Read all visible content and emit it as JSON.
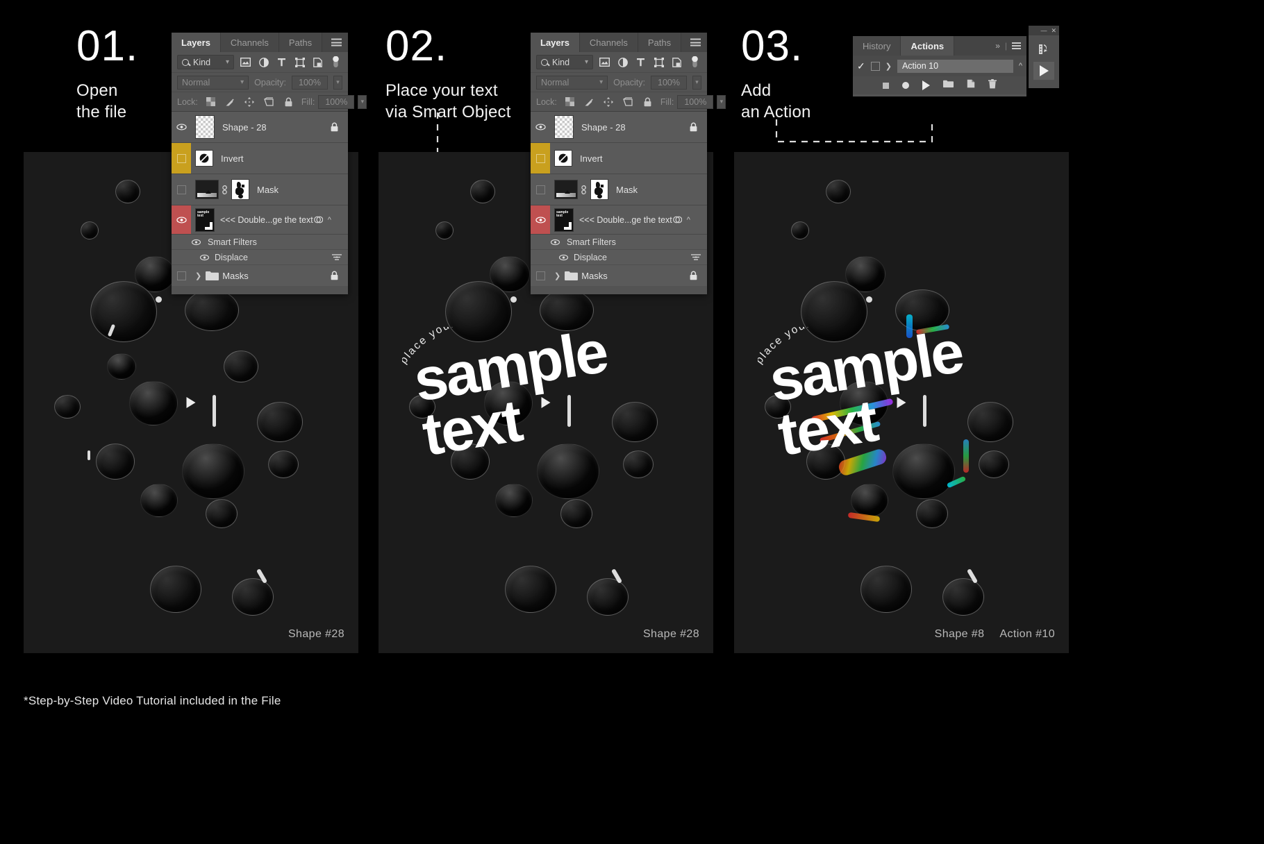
{
  "footnote": "*Step-by-Step Video Tutorial included in the File",
  "steps": [
    {
      "number": "01.",
      "title": "Open\nthe file",
      "caption": [
        "Shape #28"
      ],
      "artwork": {
        "arc_text": "",
        "sample_text": ""
      }
    },
    {
      "number": "02.",
      "title": "Place your text\nvia Smart Object",
      "caption": [
        "Shape #28"
      ],
      "artwork": {
        "arc_text": "place your text here",
        "sample_text": "sample\ntext"
      }
    },
    {
      "number": "03.",
      "title": "Add\nan Action",
      "caption": [
        "Shape #8",
        "Action #10"
      ],
      "artwork": {
        "arc_text": "place your text here",
        "sample_text": "sample\ntext"
      }
    }
  ],
  "layers_panel": {
    "tabs": [
      "Layers",
      "Channels",
      "Paths"
    ],
    "active_tab": "Layers",
    "menu_icon": "hamburger-icon",
    "filter": {
      "icon": "search-icon",
      "label": "Kind",
      "chevron": "chevron-down-icon",
      "type_icons": [
        "image-filter-icon",
        "adjustment-filter-icon",
        "type-filter-icon",
        "shape-filter-icon",
        "smartobject-filter-icon"
      ],
      "toggle": "filter-toggle-icon"
    },
    "blend": {
      "mode": "Normal",
      "chevron": "chevron-down-icon",
      "opacity_label": "Opacity:",
      "opacity_value": "100%"
    },
    "lock": {
      "label": "Lock:",
      "icons": [
        "lock-transparency-icon",
        "lock-image-icon",
        "lock-position-icon",
        "lock-artboard-icon",
        "lock-all-icon"
      ],
      "fill_label": "Fill:",
      "fill_value": "100%"
    },
    "layers": [
      {
        "name": "Shape - 28",
        "visible": true,
        "tag_color": "none",
        "thumb": "checker",
        "locked": true
      },
      {
        "name": "Invert",
        "visible": false,
        "tag_color": "#c9a01e",
        "thumb": "invert",
        "locked": false
      },
      {
        "name": "Mask",
        "visible": false,
        "tag_color": "none",
        "thumb": "mask",
        "locked": false
      },
      {
        "name": "<<<  Double...ge the text",
        "visible": true,
        "tag_color": "#bf5050",
        "thumb": "smartobject",
        "locked": false,
        "children": [
          "Smart Filters",
          "Displace"
        ]
      },
      {
        "name": "Masks",
        "visible": false,
        "tag_color": "none",
        "thumb": "folder",
        "locked": true
      }
    ],
    "smart_filters_label": "Smart Filters",
    "displace_label": "Displace"
  },
  "actions_panel": {
    "tabs": [
      "History",
      "Actions"
    ],
    "active_tab": "Actions",
    "collapse_icon": "chevron-double-right-icon",
    "menu_icon": "hamburger-icon",
    "check": "checkmark-icon",
    "expand_icon": "chevron-right-icon",
    "action_name": "Action 10",
    "collapse_arrow": "chevron-up-icon",
    "buttons": [
      "stop-icon",
      "record-icon",
      "play-icon",
      "folder-icon",
      "duplicate-icon",
      "trash-icon"
    ],
    "side_dock": {
      "minimize": "minimize-icon",
      "close": "close-icon",
      "tools": [
        "actions-tool-icon",
        "play-tool-icon"
      ]
    }
  },
  "colors": {
    "background": "#000000",
    "canvas": "#1b1b1b",
    "panel": "#535353",
    "tag_yellow": "#c9a01e",
    "tag_red": "#bf5050",
    "accent_text": "#ffffff"
  }
}
